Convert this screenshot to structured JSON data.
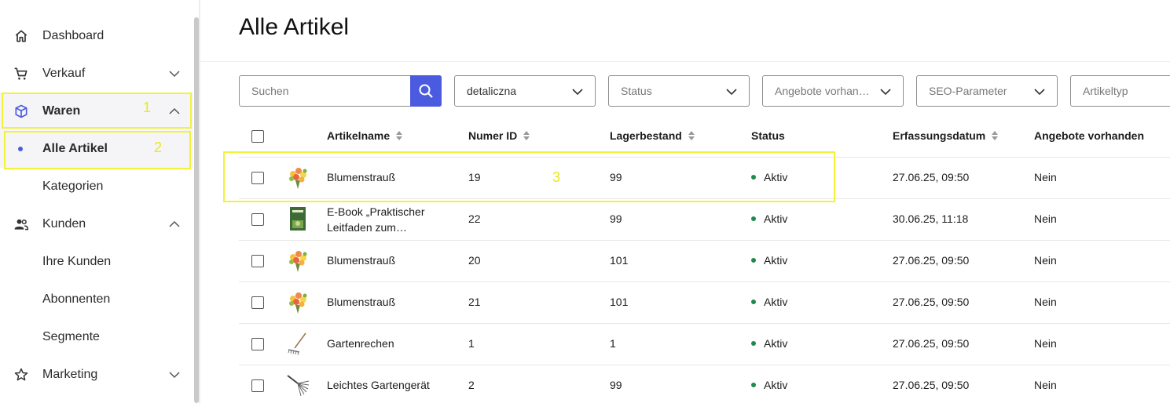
{
  "sidebar": {
    "items": [
      {
        "label": "Dashboard",
        "icon": "home-icon"
      },
      {
        "label": "Verkauf",
        "icon": "cart-icon"
      },
      {
        "label": "Waren",
        "icon": "box-icon"
      },
      {
        "label": "Alle Artikel"
      },
      {
        "label": "Kategorien"
      },
      {
        "label": "Kunden",
        "icon": "users-icon"
      },
      {
        "label": "Ihre Kunden"
      },
      {
        "label": "Abonnenten"
      },
      {
        "label": "Segmente"
      },
      {
        "label": "Marketing",
        "icon": "star-icon"
      }
    ]
  },
  "annotations": [
    "1",
    "2",
    "3"
  ],
  "page": {
    "title": "Alle Artikel"
  },
  "search": {
    "placeholder": "Suchen"
  },
  "filters": [
    {
      "label": "detaliczna"
    },
    {
      "label": "Status"
    },
    {
      "label": "Angebote vorhan…"
    },
    {
      "label": "SEO-Parameter"
    },
    {
      "label": "Artikeltyp"
    }
  ],
  "table": {
    "columns": [
      "Artikelname",
      "Numer ID",
      "Lagerbestand",
      "Status",
      "Erfassungsdatum",
      "Angebote vorhanden"
    ],
    "rows": [
      {
        "name": "Blumenstrauß",
        "name2": "",
        "id": "19",
        "stock": "99",
        "status": "Aktiv",
        "date": "27.06.25, 09:50",
        "offers": "Nein",
        "thumb": "bouquet"
      },
      {
        "name": "E-Book „Praktischer",
        "name2": "Leitfaden zum…",
        "id": "22",
        "stock": "99",
        "status": "Aktiv",
        "date": "30.06.25, 11:18",
        "offers": "Nein",
        "thumb": "book"
      },
      {
        "name": "Blumenstrauß",
        "name2": "",
        "id": "20",
        "stock": "101",
        "status": "Aktiv",
        "date": "27.06.25, 09:50",
        "offers": "Nein",
        "thumb": "bouquet"
      },
      {
        "name": "Blumenstrauß",
        "name2": "",
        "id": "21",
        "stock": "101",
        "status": "Aktiv",
        "date": "27.06.25, 09:50",
        "offers": "Nein",
        "thumb": "bouquet"
      },
      {
        "name": "Gartenrechen",
        "name2": "",
        "id": "1",
        "stock": "1",
        "status": "Aktiv",
        "date": "27.06.25, 09:50",
        "offers": "Nein",
        "thumb": "rake"
      },
      {
        "name": "Leichtes Gartengerät",
        "name2": "",
        "id": "2",
        "stock": "99",
        "status": "Aktiv",
        "date": "27.06.25, 09:50",
        "offers": "Nein",
        "thumb": "leaf-rake"
      }
    ]
  },
  "colors": {
    "accent": "#4a5be0",
    "status_active": "#1f8a4c",
    "annotation": "#f2f23a"
  }
}
